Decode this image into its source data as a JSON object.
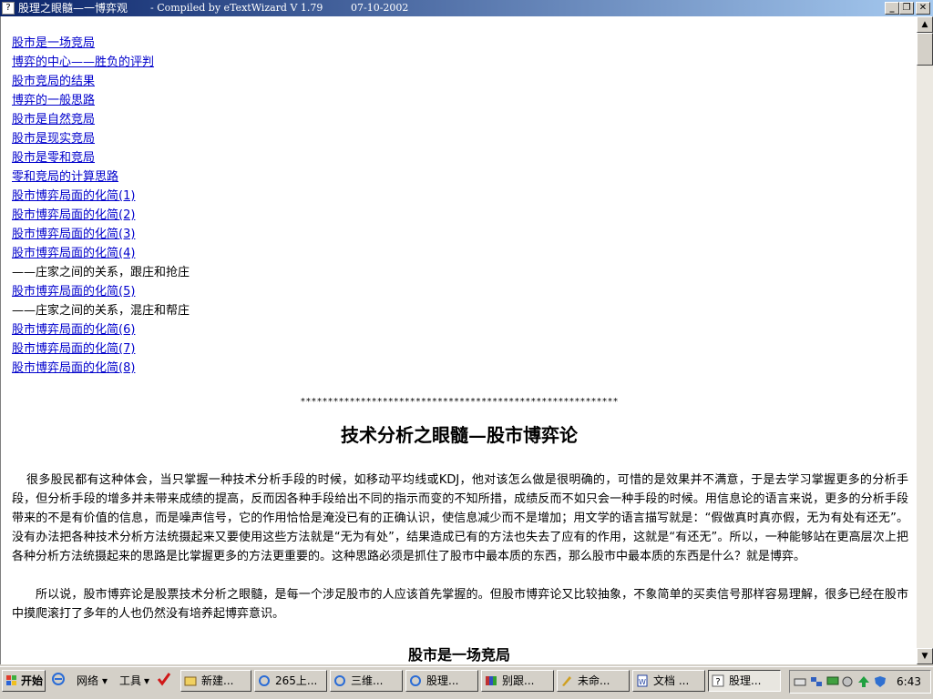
{
  "window": {
    "title": "股理之眼髓—一博弈观",
    "compiled": "- Compiled by eTextWizard V 1.79",
    "date": "07-10-2002",
    "minimize": "_",
    "restore": "❐",
    "close": "✕"
  },
  "toc": [
    {
      "text": "股市是一场竞局",
      "link": true
    },
    {
      "text": "博弈的中心——胜负的评判",
      "link": true
    },
    {
      "text": "股市竞局的结果",
      "link": true
    },
    {
      "text": "博弈的一般思路",
      "link": true
    },
    {
      "text": "股市是自然竞局",
      "link": true
    },
    {
      "text": "股市是现实竞局",
      "link": true
    },
    {
      "text": "股市是零和竞局",
      "link": true
    },
    {
      "text": "零和竞局的计算思路",
      "link": true
    },
    {
      "text": "股市博弈局面的化简(1)",
      "link": true
    },
    {
      "text": "股市博弈局面的化简(2)",
      "link": true
    },
    {
      "text": "股市博弈局面的化简(3)",
      "link": true
    },
    {
      "text": "股市博弈局面的化简(4)",
      "link": true
    },
    {
      "text": "——庄家之间的关系，跟庄和抢庄",
      "link": false
    },
    {
      "text": "股市博弈局面的化简(5)",
      "link": true
    },
    {
      "text": "——庄家之间的关系，混庄和帮庄",
      "link": false
    },
    {
      "text": "股市博弈局面的化简(6)",
      "link": true
    },
    {
      "text": "股市博弈局面的化简(7)",
      "link": true
    },
    {
      "text": "股市博弈局面的化简(8)",
      "link": true
    }
  ],
  "article": {
    "stars": "**********************************************************",
    "title": "技术分析之眼髓—股市博弈论",
    "paragraph1": "很多股民都有这种体会，当只掌握一种技术分析手段的时候，如移动平均线或KDJ，他对该怎么做是很明确的，可惜的是效果并不满意，于是去学习掌握更多的分析手段，但分析手段的增多并未带来成绩的提高，反而因各种手段给出不同的指示而变的不知所措，成绩反而不如只会一种手段的时候。用信息论的语言来说，更多的分析手段带来的不是有价值的信息，而是噪声信号，它的作用恰恰是淹没已有的正确认识，使信息减少而不是增加；用文学的语言描写就是：“假做真时真亦假，无为有处有还无”。没有办法把各种技术分析方法统摄起来又要使用这些方法就是“无为有处”，结果造成已有的方法也失去了应有的作用，这就是“有还无”。所以，一种能够站在更高层次上把各种分析方法统摄起来的思路是比掌握更多的方法更重要的。这种思路必须是抓住了股市中最本质的东西，那么股市中最本质的东西是什么？就是博弈。",
    "paragraph2": "所以说，股市博弈论是股票技术分析之眼髓，是每一个涉足股市的人应该首先掌握的。但股市博弈论又比较抽象，不象简单的买卖信号那样容易理解，很多已经在股市中摸爬滚打了多年的人也仍然没有培养起博弈意识。",
    "section_title": "股市是一场竞局"
  },
  "taskbar": {
    "start": "开始",
    "network": "网络",
    "tools": "工具",
    "tasks": [
      "新建...",
      "265上...",
      "三维...",
      "股理...",
      "别跟...",
      "未命...",
      "文档 ...",
      "股理..."
    ],
    "active_task": 7,
    "clock": "6:43"
  },
  "colors": {
    "titlebar_start": "#0a246a",
    "titlebar_end": "#a6caf0",
    "link": "#0000cc"
  }
}
